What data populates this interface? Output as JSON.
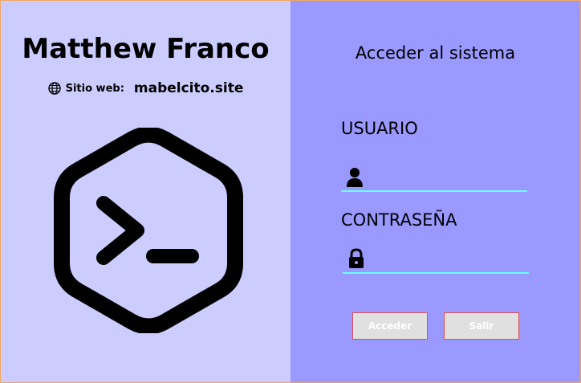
{
  "profile": {
    "name": "Matthew Franco",
    "site_label": "Sitio web:",
    "site_value": "mabelcito.site",
    "globe_icon": "globe-icon",
    "logo_icon": "terminal-hexagon-logo"
  },
  "login": {
    "heading": "Acceder al sistema",
    "user_label": "USUARIO",
    "user_value": "",
    "user_icon": "user-icon",
    "password_label": "CONTRASEÑA",
    "password_value": "",
    "password_icon": "lock-icon",
    "login_button": "Acceder",
    "exit_button": "Salir"
  },
  "colors": {
    "left_panel": "#ccccff",
    "right_panel": "#9999ff",
    "field_underline": "#66ffff",
    "button_bg": "#e0e0e0",
    "button_border": "#e05050"
  }
}
